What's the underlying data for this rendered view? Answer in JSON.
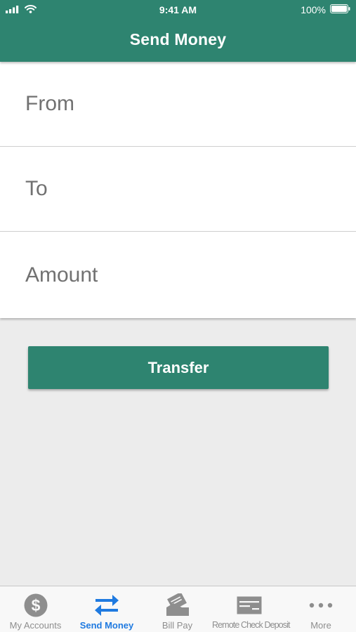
{
  "status_bar": {
    "time": "9:41 AM",
    "battery": "100%"
  },
  "header": {
    "title": "Send Money"
  },
  "form": {
    "from_label": "From",
    "to_label": "To",
    "amount_label": "Amount"
  },
  "actions": {
    "transfer_label": "Transfer"
  },
  "tabs": [
    {
      "label": "My Accounts",
      "icon": "dollar-circle-icon",
      "active": false
    },
    {
      "label": "Send Money",
      "icon": "transfer-arrows-icon",
      "active": true
    },
    {
      "label": "Bill Pay",
      "icon": "bill-pay-icon",
      "active": false
    },
    {
      "label": "Remote Check Deposit",
      "icon": "check-icon",
      "active": false
    },
    {
      "label": "More",
      "icon": "more-dots-icon",
      "active": false
    }
  ],
  "colors": {
    "brand_green": "#2e8470",
    "active_tab_blue": "#1f7ae0",
    "inactive_tab_gray": "#8e8e8e",
    "background": "#ececec"
  }
}
